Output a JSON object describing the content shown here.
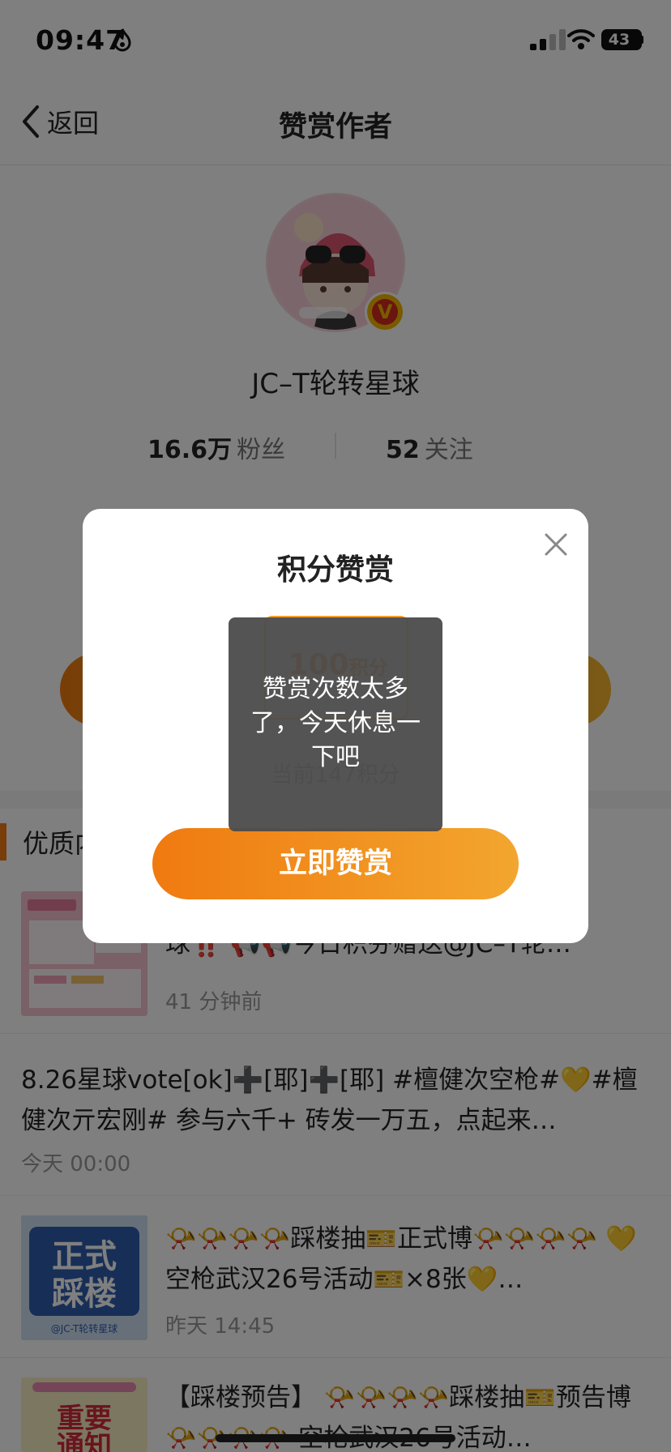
{
  "status_bar": {
    "time": "09:47",
    "battery": "43",
    "icons": [
      "flame-icon",
      "signal-icon",
      "wifi-icon",
      "battery-icon"
    ]
  },
  "nav": {
    "back_label": "返回",
    "title": "赞赏作者"
  },
  "profile": {
    "name": "JC–T轮转星球",
    "verified_badge": "V",
    "fans_count": "16.6万",
    "fans_label": "粉丝",
    "follow_count": "52",
    "follow_label": "关注"
  },
  "section": {
    "title": "优质内"
  },
  "feed": [
    {
      "text": "球‼️ 📢📢今日积芬赠送@JC–T轮…",
      "time": "41 分钟前",
      "has_thumb": true
    },
    {
      "text": "8.26星球vote[ok]➕[耶]➕[耶] #檀健次空枪#💛#檀健次亓宏刚# 参与六千+ 砖发一万五，点起来…",
      "time": "今天 00:00",
      "has_thumb": false
    },
    {
      "text": "📯📯📯📯踩楼抽🎫正式博📯📯📯📯 💛空枪武汉26号活动🎫×8张💛…",
      "time": "昨天 14:45",
      "has_thumb": true,
      "thumb_text": "正式踩楼",
      "thumb_caption": "@JC-T轮转星球"
    },
    {
      "text": "【踩楼预告】 📯📯📯📯踩楼抽🎫预告博📯📯📯📯 空枪武汉26号活动…",
      "time": "",
      "has_thumb": true,
      "thumb_text": "重要通知"
    }
  ],
  "dialog": {
    "title": "积分赞赏",
    "amount": "100",
    "amount_unit": "积分",
    "balance": "当前147积分",
    "submit_label": "立即赞赏"
  },
  "toast": {
    "message": "赞赏次数太多了，今天休息一下吧"
  },
  "colors": {
    "accent_orange": "#f07a10",
    "accent_gold": "#f2a623",
    "toast_bg": "#4b4b4b",
    "badge_red": "#d42a1e"
  }
}
